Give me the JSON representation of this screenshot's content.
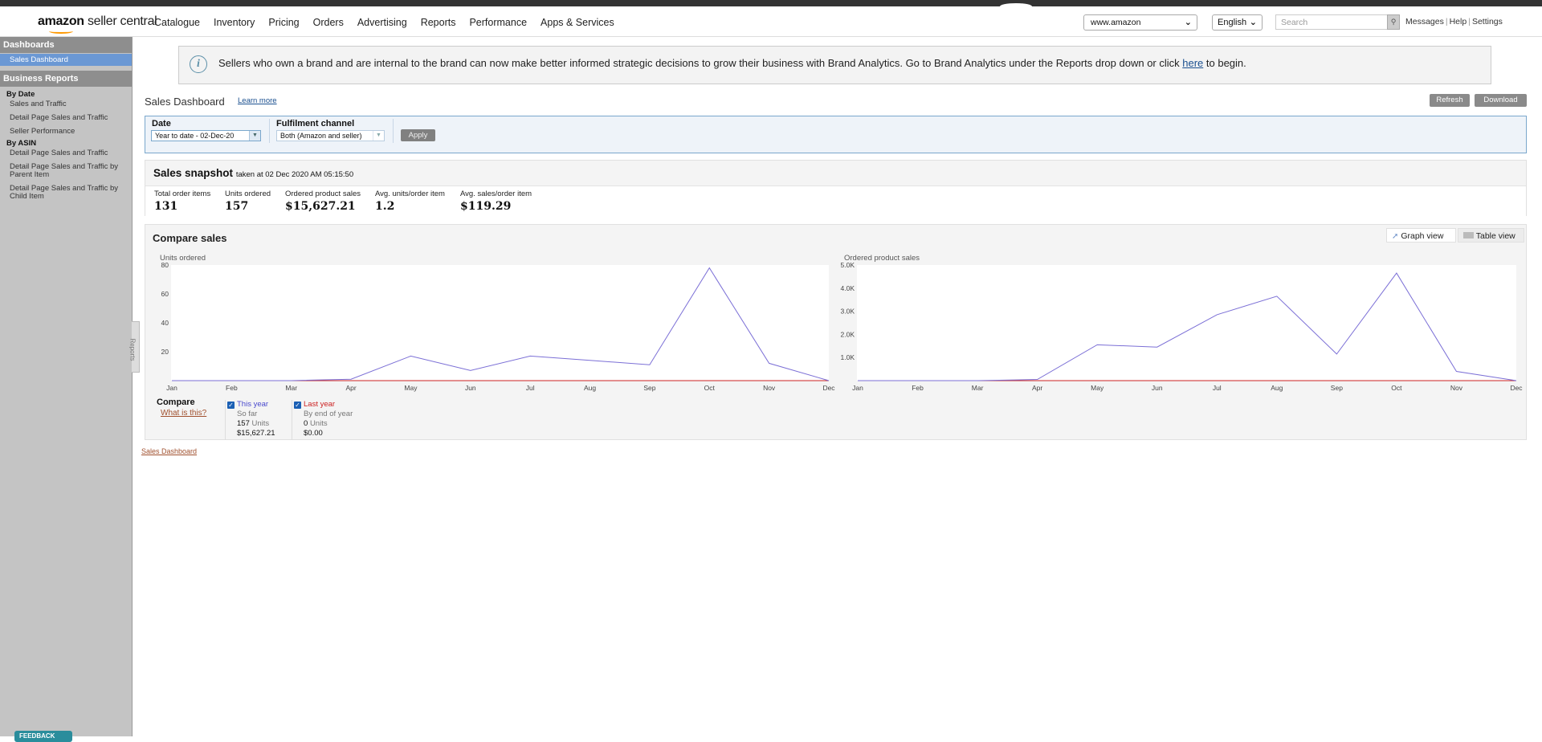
{
  "header": {
    "logo_brand": "amazon",
    "logo_product": "seller central",
    "nav": [
      "Catalogue",
      "Inventory",
      "Pricing",
      "Orders",
      "Advertising",
      "Reports",
      "Performance",
      "Apps & Services"
    ],
    "store_value": "www.amazon",
    "language": "English",
    "search_placeholder": "Search",
    "links": [
      "Messages",
      "Help",
      "Settings"
    ]
  },
  "sidebar": {
    "dashboards_title": "Dashboards",
    "active_item": "Sales Dashboard",
    "business_reports_title": "Business Reports",
    "by_date_title": "By Date",
    "by_date_items": [
      "Sales and Traffic",
      "Detail Page Sales and Traffic",
      "Seller Performance"
    ],
    "by_asin_title": "By ASIN",
    "by_asin_items": [
      "Detail Page Sales and Traffic",
      "Detail Page Sales and Traffic by Parent Item",
      "Detail Page Sales and Traffic by Child Item"
    ],
    "tab_label": "Reports",
    "feedback_label": "FEEDBACK"
  },
  "banner": {
    "text": "Sellers who own a brand and are internal to the brand can now make better informed strategic decisions to grow their business with Brand Analytics. Go to Brand Analytics under the Reports drop down or click ",
    "link": "here",
    "text_end": " to begin."
  },
  "page": {
    "title": "Sales Dashboard",
    "learn_more": "Learn more",
    "refresh": "Refresh",
    "download": "Download"
  },
  "filters": {
    "date_label": "Date",
    "date_value": "Year to date - 02-Dec-20",
    "channel_label": "Fulfilment channel",
    "channel_value": "Both (Amazon and seller)",
    "apply": "Apply"
  },
  "snapshot": {
    "title": "Sales snapshot",
    "taken": "taken at 02 Dec 2020 AM 05:15:50",
    "metrics": [
      {
        "label": "Total order items",
        "value": "131"
      },
      {
        "label": "Units ordered",
        "value": "157"
      },
      {
        "label": "Ordered product sales",
        "value": "$15,627.21"
      },
      {
        "label": "Avg. units/order item",
        "value": "1.2"
      },
      {
        "label": "Avg. sales/order item",
        "value": "$119.29"
      }
    ]
  },
  "compare": {
    "title": "Compare sales",
    "graph_view": "Graph view",
    "table_view": "Table view",
    "compare_label": "Compare",
    "what_is_this": "What is this?",
    "this_year": {
      "label": "This year",
      "sub": "So far",
      "units_value": "157",
      "units_label": "Units",
      "sales": "$15,627.21",
      "color": "#4a4acd"
    },
    "last_year": {
      "label": "Last year",
      "sub": "By end of year",
      "units_value": "0",
      "units_label": "Units",
      "sales": "$0.00",
      "color": "#cc2222"
    }
  },
  "chart_data": [
    {
      "type": "line",
      "ylabel": "Units ordered",
      "categories": [
        "Jan",
        "Feb",
        "Mar",
        "Apr",
        "May",
        "Jun",
        "Jul",
        "Aug",
        "Sep",
        "Oct",
        "Nov",
        "Dec"
      ],
      "y_ticks": [
        "20",
        "40",
        "60",
        "80"
      ],
      "ylim": [
        0,
        80
      ],
      "series": [
        {
          "name": "This year",
          "color": "#7b6fd6",
          "values": [
            0,
            0,
            0,
            1,
            17,
            7,
            17,
            14,
            11,
            78,
            12,
            0
          ]
        },
        {
          "name": "Last year",
          "color": "#cc2222",
          "values": [
            0,
            0,
            0,
            0,
            0,
            0,
            0,
            0,
            0,
            0,
            0,
            0
          ]
        }
      ]
    },
    {
      "type": "line",
      "ylabel": "Ordered product sales",
      "categories": [
        "Jan",
        "Feb",
        "Mar",
        "Apr",
        "May",
        "Jun",
        "Jul",
        "Aug",
        "Sep",
        "Oct",
        "Nov",
        "Dec"
      ],
      "y_ticks": [
        "1.0K",
        "2.0K",
        "3.0K",
        "4.0K",
        "5.0K"
      ],
      "ylim": [
        0,
        5000
      ],
      "series": [
        {
          "name": "This year",
          "color": "#7b6fd6",
          "values": [
            0,
            0,
            0,
            50,
            1550,
            1450,
            2850,
            3650,
            1150,
            4650,
            400,
            0
          ]
        },
        {
          "name": "Last year",
          "color": "#cc2222",
          "values": [
            0,
            0,
            0,
            0,
            0,
            0,
            0,
            0,
            0,
            0,
            0,
            0
          ]
        }
      ]
    }
  ],
  "footer": {
    "link": "Sales Dashboard"
  }
}
